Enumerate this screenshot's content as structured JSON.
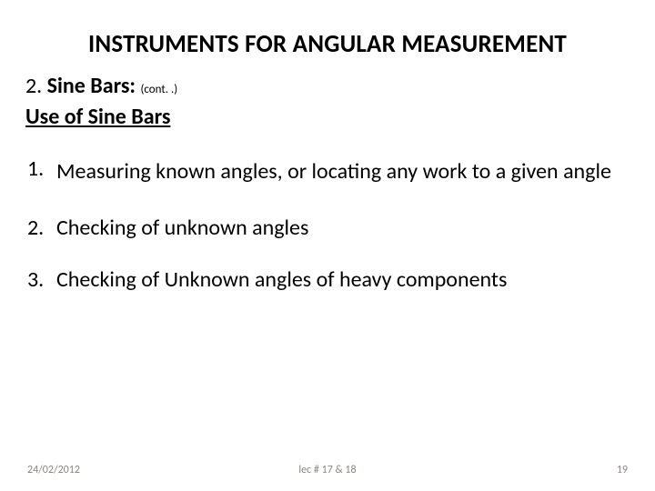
{
  "title": "INSTRUMENTS FOR ANGULAR MEASUREMENT",
  "heading": {
    "number": "2.",
    "label": "Sine Bars:",
    "cont": "(cont. .)"
  },
  "subheading": "Use of Sine Bars",
  "items": [
    {
      "num": "1.",
      "text": "Measuring known angles, or locating any work to a given angle"
    },
    {
      "num": "2.",
      "text": "Checking of unknown angles"
    },
    {
      "num": "3.",
      "text": "Checking of Unknown angles of heavy components"
    }
  ],
  "footer": {
    "date": "24/02/2012",
    "center": "lec # 17 & 18",
    "page": "19"
  }
}
